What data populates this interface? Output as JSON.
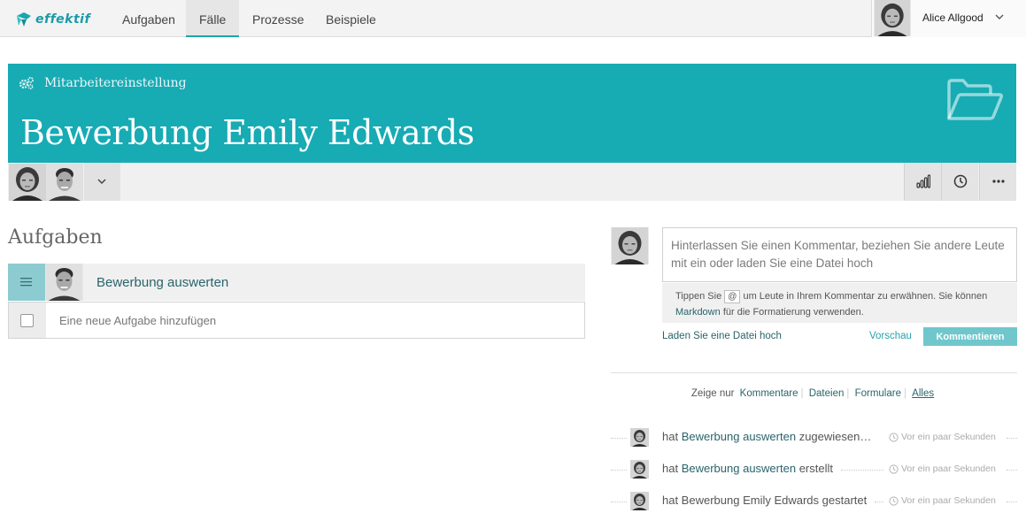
{
  "nav": {
    "brand": "effektif",
    "items": [
      "Aufgaben",
      "Fälle",
      "Prozesse",
      "Beispiele"
    ],
    "active": "Fälle",
    "user_name": "Alice Allgood"
  },
  "case": {
    "process_name": "Mitarbeitereinstellung",
    "title": "Bewerbung Emily Edwards",
    "accent_color": "#17abb4"
  },
  "tasks": {
    "heading": "Aufgaben",
    "items": [
      {
        "label": "Bewerbung auswerten"
      }
    ],
    "new_task_placeholder": "Eine neue Aufgabe hinzufügen"
  },
  "comment": {
    "placeholder": "Hinterlassen Sie einen Kommentar, beziehen Sie andere Leute mit ein oder laden Sie eine Datei hoch",
    "hint_part1": "Tippen Sie",
    "hint_at": "@",
    "hint_part2": "um Leute in Ihrem Kommentar zu erwähnen. Sie können",
    "hint_markdown": "Markdown",
    "hint_part3": "für die Formatierung verwenden.",
    "upload_label": "Laden Sie eine Datei hoch",
    "preview_label": "Vorschau",
    "submit_label": "Kommentieren"
  },
  "filter": {
    "prefix": "Zeige nur",
    "options": [
      "Kommentare",
      "Dateien",
      "Formulare",
      "Alles"
    ],
    "active": "Alles"
  },
  "activity": [
    {
      "pre": "hat",
      "link": "Bewerbung auswerten",
      "post": "zugewiesen…",
      "time": "Vor ein paar Sekunden"
    },
    {
      "pre": "hat",
      "link": "Bewerbung auswerten",
      "post": "erstellt",
      "time": "Vor ein paar Sekunden"
    },
    {
      "pre": "hat Bewerbung Emily Edwards gestartet",
      "link": "",
      "post": "",
      "time": "Vor ein paar Sekunden"
    }
  ]
}
